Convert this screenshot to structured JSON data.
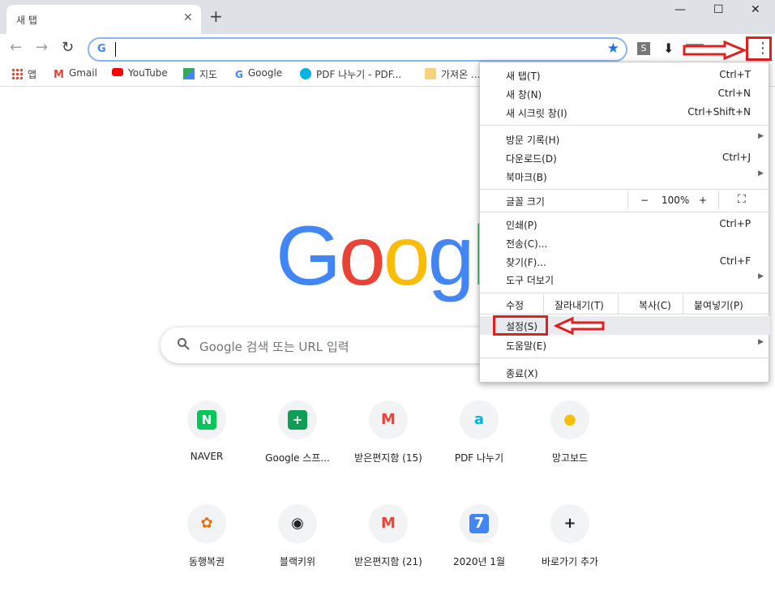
{
  "tab": {
    "title": "새 탭",
    "close": "✕",
    "new_tab": "+"
  },
  "window": {
    "minimize": "—",
    "maximize": "☐",
    "close": "✕"
  },
  "toolbar": {
    "back": "←",
    "forward": "→",
    "reload": "↻",
    "g_icon": "G",
    "star": "★",
    "ext_s": "S",
    "menu_dots": "⋮"
  },
  "bookmarks": [
    {
      "label": "앱",
      "icon": "apps-grid-icon"
    },
    {
      "label": "Gmail",
      "icon": "gmail-icon"
    },
    {
      "label": "YouTube",
      "icon": "youtube-icon"
    },
    {
      "label": "지도",
      "icon": "maps-icon"
    },
    {
      "label": "Google",
      "icon": "google-icon"
    },
    {
      "label": "PDF 나누기 - PDF...",
      "icon": "pdf-icon"
    },
    {
      "label": "가져온 ...",
      "icon": "folder-icon"
    }
  ],
  "search": {
    "placeholder": "Google 검색 또는 URL 입력"
  },
  "logo": "Google",
  "tiles_row1": [
    {
      "label": "NAVER",
      "glyph": "N",
      "color": "#03c75a"
    },
    {
      "label": "Google 스프...",
      "glyph": "+",
      "color": "#0f9d58"
    },
    {
      "label": "받은편지함 (15)",
      "glyph": "M",
      "color": "#ea4335"
    },
    {
      "label": "PDF 나누기",
      "glyph": "a",
      "color": "#00b3e3"
    },
    {
      "label": "망고보드",
      "glyph": "●",
      "color": "#f4c20d"
    }
  ],
  "tiles_row2": [
    {
      "label": "동행복권",
      "glyph": "✿",
      "color": "#e8710a"
    },
    {
      "label": "블랙키위",
      "glyph": "◉",
      "color": "#202124"
    },
    {
      "label": "받은편지함 (21)",
      "glyph": "M",
      "color": "#ea4335"
    },
    {
      "label": "2020년 1월",
      "glyph": "7",
      "color": "#4285f4"
    },
    {
      "label": "바로가기 추가",
      "glyph": "+",
      "color": "#202124"
    }
  ],
  "menu": {
    "new_tab": {
      "label": "새 탭(T)",
      "shortcut": "Ctrl+T"
    },
    "new_window": {
      "label": "새 창(N)",
      "shortcut": "Ctrl+N"
    },
    "incognito": {
      "label": "새 시크릿 창(I)",
      "shortcut": "Ctrl+Shift+N"
    },
    "history": {
      "label": "방문 기록(H)"
    },
    "downloads": {
      "label": "다운로드(D)",
      "shortcut": "Ctrl+J"
    },
    "bookmarks": {
      "label": "북마크(B)"
    },
    "zoom": {
      "label": "글꼴 크기",
      "minus": "−",
      "value": "100%",
      "plus": "+",
      "fullscreen": "⛶"
    },
    "print": {
      "label": "인쇄(P)",
      "shortcut": "Ctrl+P"
    },
    "cast": {
      "label": "전송(C)..."
    },
    "find": {
      "label": "찾기(F)...",
      "shortcut": "Ctrl+F"
    },
    "more_tools": {
      "label": "도구 더보기"
    },
    "edit": {
      "label": "수정",
      "cut": "잘라내기(T)",
      "copy": "복사(C)",
      "paste": "붙여넣기(P)"
    },
    "settings": {
      "label": "설정(S)"
    },
    "help": {
      "label": "도움말(E)"
    },
    "exit": {
      "label": "종료(X)"
    }
  },
  "colors": {
    "accent": "#1a73e8",
    "annotation_red": "#e02020"
  }
}
